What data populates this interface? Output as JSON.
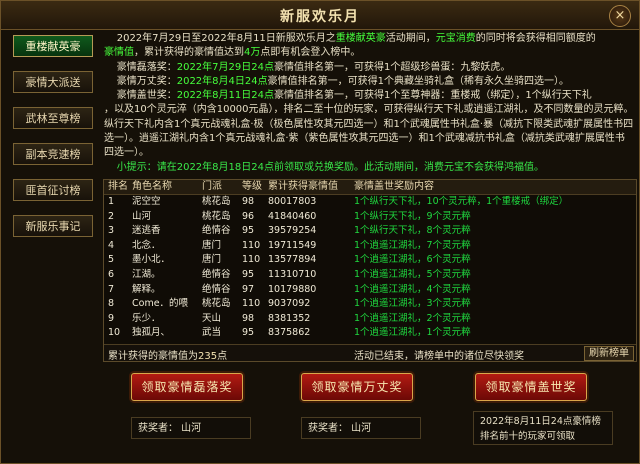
{
  "window": {
    "title": "新服欢乐月",
    "close_label": "×"
  },
  "sidebar": {
    "items": [
      {
        "label": "重楼献英豪",
        "active": true
      },
      {
        "label": "豪情大派送"
      },
      {
        "label": "武林至尊榜"
      },
      {
        "label": "副本竞速榜"
      },
      {
        "label": "匪首征讨榜"
      },
      {
        "label": "新服乐事记"
      }
    ]
  },
  "desc": {
    "l1a": "2022年7月29日至2022年8月11日新服欢乐月之",
    "l1b": "重楼献英豪",
    "l1c": "活动期间，",
    "l1d": "元宝消费",
    "l1e": "的同时将会获得相同额度的",
    "l2a": "豪情值",
    "l2b": "，累计获得的豪情值达到",
    "l2c": "4万",
    "l2d": "点即有机会登入榜中。",
    "l3a": "豪情磊落奖：",
    "l3b": "2022年7月29日24点",
    "l3c": "豪情值排名第一，可获得1个超级珍兽蛋：九黎妖虎。",
    "l4a": "豪情万丈奖：",
    "l4b": "2022年8月4日24点",
    "l4c": "豪情值排名第一，可获得1个典藏坐骑礼盒（稀有永久坐骑四选一）。",
    "l5a": "豪情盖世奖：",
    "l5b": "2022年8月11日24点",
    "l5c": "豪情值排名第一，可获得1个至尊神器：重楼戒（绑定），1个纵行天下礼",
    "l6": "，以及10个灵元淬（内含10000元晶），排名二至十位的玩家，可获得纵行天下礼或逍遥江湖礼，及不同数量的灵元粹。纵行天下礼内含1个真元战魂礼盒·极（极色属性攻其元四选一）和1个武魂属性书礼盒·暴（减抗下限类武魂扩展属性书四选一）。逍遥江湖礼内含1个真元战魂礼盒·紫（紫色属性攻其元四选一）和1个武魂减抗书礼盒（减抗类武魂扩展属性书四选一）。",
    "tip": "小提示：请在2022年8月18日24点前领取或兑换奖励。此活动期间，消费元宝不会获得鸿福值。"
  },
  "table": {
    "headers": [
      "排名",
      "角色名称",
      "门派",
      "等级",
      "累计获得豪情值",
      "豪情盖世奖励内容"
    ],
    "rows": [
      {
        "rank": "1",
        "name": "泥空空",
        "school": "桃花岛",
        "level": "98",
        "value": "80017803",
        "reward": "1个纵行天下礼，10个灵元粹，1个重楼戒（绑定）"
      },
      {
        "rank": "2",
        "name": "山河",
        "school": "桃花岛",
        "level": "96",
        "value": "41840460",
        "reward": "1个纵行天下礼，9个灵元粹"
      },
      {
        "rank": "3",
        "name": "迷逃香",
        "school": "绝情谷",
        "level": "95",
        "value": "39579254",
        "reward": "1个纵行天下礼，8个灵元粹"
      },
      {
        "rank": "4",
        "name": "北念．",
        "school": "唐门",
        "level": "110",
        "value": "19711549",
        "reward": "1个逍遥江湖礼，7个灵元粹"
      },
      {
        "rank": "5",
        "name": "墨小北．",
        "school": "唐门",
        "level": "110",
        "value": "13577894",
        "reward": "1个逍遥江湖礼，6个灵元粹"
      },
      {
        "rank": "6",
        "name": "江湖。",
        "school": "绝情谷",
        "level": "95",
        "value": "11310710",
        "reward": "1个逍遥江湖礼，5个灵元粹"
      },
      {
        "rank": "7",
        "name": "解释。",
        "school": "绝情谷",
        "level": "97",
        "value": "10179880",
        "reward": "1个逍遥江湖礼，4个灵元粹"
      },
      {
        "rank": "8",
        "name": "Come．的喂",
        "school": "桃花岛",
        "level": "110",
        "value": "9037092",
        "reward": "1个逍遥江湖礼，3个灵元粹"
      },
      {
        "rank": "9",
        "name": "乐少．",
        "school": "天山",
        "level": "98",
        "value": "8381352",
        "reward": "1个逍遥江湖礼，2个灵元粹"
      },
      {
        "rank": "10",
        "name": "独孤月、",
        "school": "武当",
        "level": "95",
        "value": "8375862",
        "reward": "1个逍遥江湖礼，1个灵元粹"
      }
    ],
    "total_prefix": "累计获得的豪情值为",
    "total_value": "235",
    "total_suffix": "点",
    "status": "活动已结束，请榜单中的诸位尽快领奖",
    "refresh_label": "刷新榜单"
  },
  "buttons": {
    "b1": "领取豪情磊落奖",
    "b2": "领取豪情万丈奖",
    "b3": "领取豪情盖世奖"
  },
  "winners": {
    "w1": "获奖者：  山河",
    "w2": "获奖者：  山河"
  },
  "note": {
    "l1": "2022年8月11日24点豪情榜",
    "l2": "排名前十的玩家可领取"
  }
}
